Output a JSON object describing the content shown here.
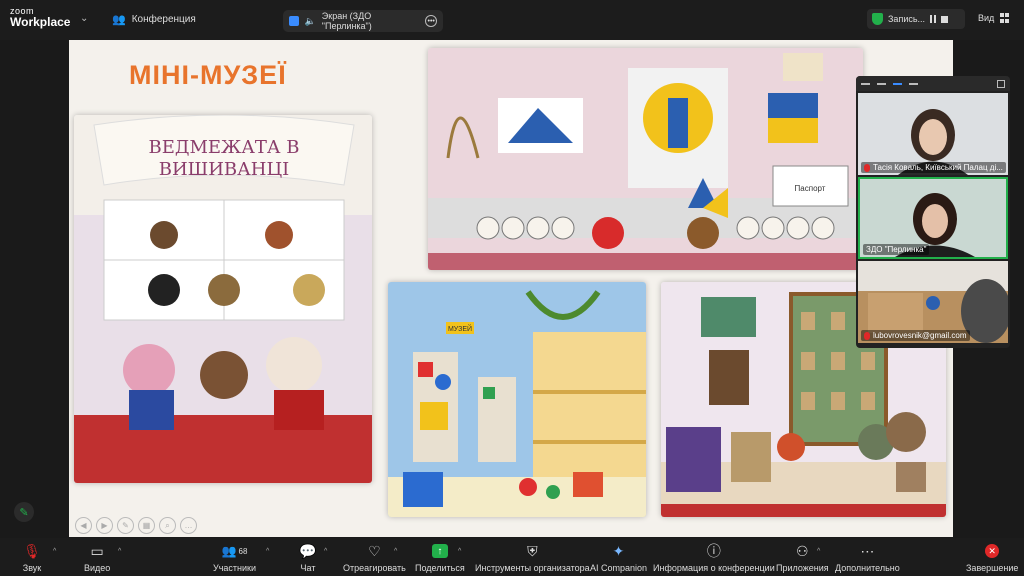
{
  "app": {
    "logo_line1": "zoom",
    "logo_line2": "Workplace"
  },
  "header": {
    "conference_label": "Конференция",
    "screen_share_label": "Экран (ЗДО \"Перлинка\")",
    "recording_label": "Запись...",
    "view_label": "Вид"
  },
  "slide": {
    "title": "МІНІ-МУЗЕЇ",
    "banner_text_line1": "ВЕДМЕЖАТА В",
    "banner_text_line2": "ВИШИВАНЦІ",
    "passport_label": "Паспорт",
    "museum_label": "МУЗЕЙ"
  },
  "participants": [
    {
      "name": "Тасія Коваль, Київський Палац ді...",
      "muted": true
    },
    {
      "name": "ЗДО \"Перлинка\"",
      "muted": false
    },
    {
      "name": "lubovrovesnik@gmail.com",
      "muted": true
    }
  ],
  "toolbar": {
    "audio": "Звук",
    "video": "Видео",
    "participants": "Участники",
    "participants_count": "68",
    "chat": "Чат",
    "react": "Отреагировать",
    "share": "Поделиться",
    "host_tools": "Инструменты организатора",
    "ai": "AI Companion",
    "info": "Информация о конференции",
    "apps": "Приложения",
    "more": "Дополнительно",
    "end": "Завершение"
  },
  "colors": {
    "accent_green": "#22b04b",
    "end_red": "#e02828",
    "title_orange": "#e8742c"
  }
}
